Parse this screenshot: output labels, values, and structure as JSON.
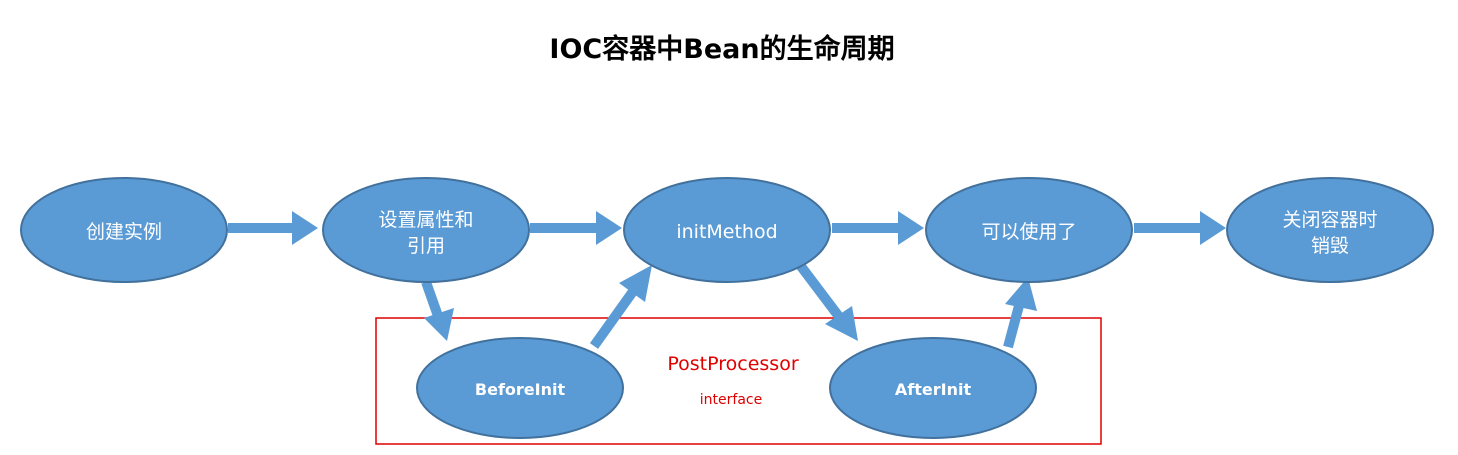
{
  "title": "IOC容器中Bean的生命周期",
  "nodes": {
    "create": {
      "label": "创建实例"
    },
    "set_props": {
      "line1": "设置属性和",
      "line2": "引用"
    },
    "init_method": {
      "label": "initMethod"
    },
    "usable": {
      "label": "可以使用了"
    },
    "destroy": {
      "line1": "关闭容器时",
      "line2": "销毁"
    },
    "before_init": {
      "label": "BeforeInit"
    },
    "after_init": {
      "label": "AfterInit"
    }
  },
  "postprocessor": {
    "title": "PostProcessor",
    "subtitle": "interface"
  },
  "colors": {
    "node_fill": "#5b9bd5",
    "node_stroke": "#41719c",
    "arrow": "#5b9bd5",
    "postprocessor": "#e00000"
  }
}
